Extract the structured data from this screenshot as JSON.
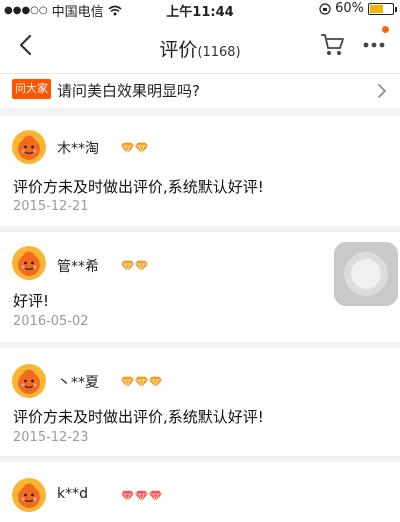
{
  "status_bar": {
    "carrier": "中国电信",
    "time": "上午11:44",
    "battery_text": "60%",
    "battery_level": 0.6
  },
  "nav": {
    "title": "评价",
    "count": "(1168)"
  },
  "qa": {
    "tag": "问大家",
    "question": "请问美白效果明显吗?"
  },
  "reviews": [
    {
      "nickname": "木**淘",
      "badge_count": 2,
      "badge_color": "#f5a623",
      "content": "评价方未及时做出评价,系统默认好评!",
      "date": "2015-12-21"
    },
    {
      "nickname": "管**希",
      "badge_count": 2,
      "badge_color": "#f5a623",
      "content": "好评!",
      "date": "2016-05-02"
    },
    {
      "nickname": "丶**夏",
      "badge_count": 3,
      "badge_color": "#f5a623",
      "content": "评价方未及时做出评价,系统默认好评!",
      "date": "2015-12-23"
    },
    {
      "nickname": "k**d",
      "badge_count": 3,
      "badge_color": "#ff4d6a",
      "content": "",
      "date": ""
    }
  ],
  "colors": {
    "accent": "#ff5500",
    "gem_gold": "#f5a623",
    "gem_red": "#ff4d6a"
  }
}
